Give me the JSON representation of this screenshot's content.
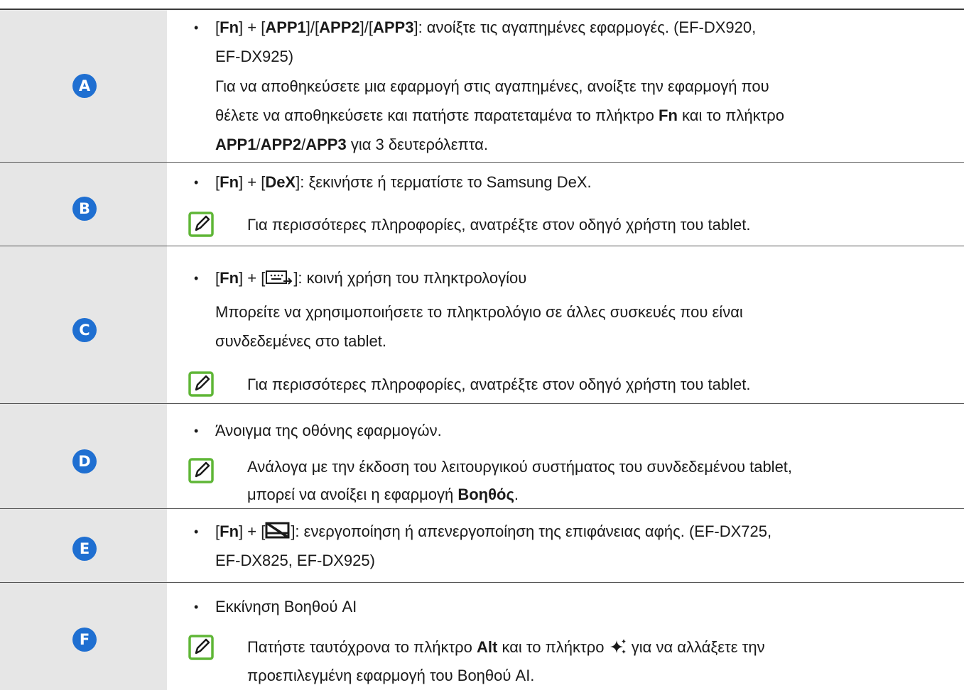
{
  "colors": {
    "badge": "#1f6fd1",
    "label_cell": "#e6e6e6",
    "note_icon": "#5fb636"
  },
  "icons": {
    "note": "note-pencil-icon",
    "share": "keyboard-share-icon",
    "touchpad": "touchpad-off-icon",
    "ai": "sparkle-ai-icon"
  },
  "rows": [
    {
      "badge": "A",
      "l1": {
        "b1": "[",
        "k1": "Fn",
        "b2": "] + [",
        "k2": "APP1",
        "b3": "]/[",
        "k3": "APP2",
        "b4": "]/[",
        "k4": "APP3",
        "rest": "]: ανοίξτε τις αγαπημένες εφαρμογές. (EF-DX920,"
      },
      "l2": "EF-DX925)",
      "l3": "Για να αποθηκεύσετε μια εφαρμογή στις αγαπημένες, ανοίξτε την εφαρμογή που",
      "l4": {
        "t1": "θέλετε να αποθηκεύσετε και πατήστε παρατεταμένα το πλήκτρο ",
        "k1": "Fn",
        "t2": " και το πλήκτρο"
      },
      "l5": {
        "k1": "APP1",
        "s1": "/",
        "k2": "APP2",
        "s2": "/",
        "k3": "APP3",
        "t1": " για 3 δευτερόλεπτα."
      }
    },
    {
      "badge": "B",
      "l1": {
        "b1": "[",
        "k1": "Fn",
        "b2": "] + [",
        "k2": "DeX",
        "rest": "]: ξεκινήστε ή τερματίστε το Samsung DeX."
      },
      "note": "Για περισσότερες πληροφορίες, ανατρέξτε στον οδηγό χρήστη του tablet."
    },
    {
      "badge": "C",
      "l1": {
        "b1": "[",
        "k1": "Fn",
        "b2": "] + [",
        "b3": "]: κοινή χρήση του πληκτρολογίου"
      },
      "l2": "Μπορείτε να χρησιμοποιήσετε το πληκτρολόγιο σε άλλες συσκευές που είναι",
      "l3": "συνδεδεμένες στο tablet.",
      "note": "Για περισσότερες πληροφορίες, ανατρέξτε στον οδηγό χρήστη του tablet."
    },
    {
      "badge": "D",
      "l1": "Άνοιγμα της οθόνης εφαρμογών.",
      "note1": "Ανάλογα με την έκδοση του λειτουργικού συστήματος του συνδεδεμένου tablet,",
      "note2": {
        "t1": "μπορεί να ανοίξει η εφαρμογή ",
        "k1": "Βοηθός",
        "t2": "."
      }
    },
    {
      "badge": "E",
      "l1": {
        "b1": "[",
        "k1": "Fn",
        "b2": "] + [",
        "rest": "]: ενεργοποίηση ή απενεργοποίηση της επιφάνειας αφής. (EF-DX725,"
      },
      "l2": "EF-DX825, EF-DX925)"
    },
    {
      "badge": "F",
      "l1": "Εκκίνηση Βοηθού AI",
      "note1": {
        "t1": "Πατήστε ταυτόχρονα το πλήκτρο ",
        "k1": "Alt",
        "t2": " και το πλήκτρο ",
        "t3": " για να αλλάξετε την"
      },
      "note2": "προεπιλεγμένη εφαρμογή του Βοηθού AI."
    }
  ]
}
